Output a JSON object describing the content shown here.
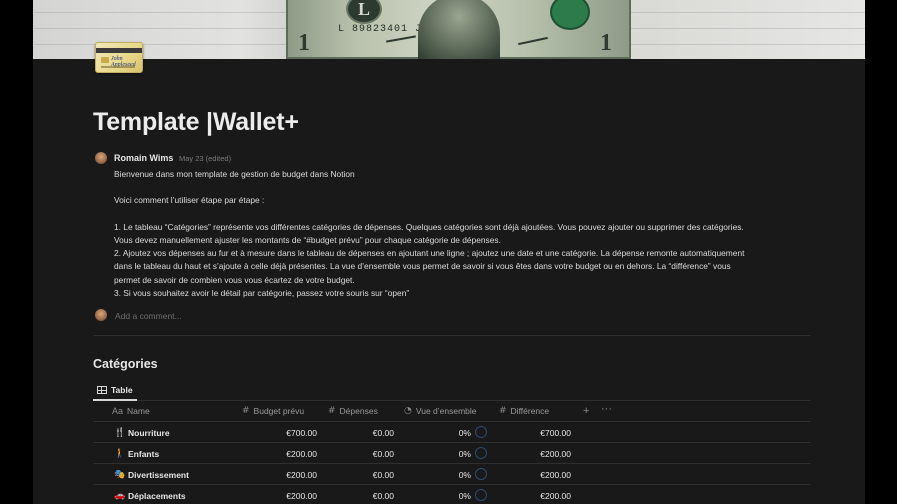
{
  "page": {
    "title": "Template |Wallet+",
    "icon": "credit-card-icon",
    "cover": "dollar-bill-cover-image",
    "cover_text": {
      "serial": "L 89823401 J",
      "seal_letter": "L",
      "denomination": "1"
    },
    "card_icon_signature": "John Appleseed"
  },
  "comment": {
    "author": "Romain Wims",
    "meta": "May 23 (edited)",
    "lines": [
      "Bienvenue dans mon template de gestion de budget dans Notion",
      "",
      "Voici comment l’utiliser étape par étape :",
      "",
      "1. Le tableau “Catégories” représente vos différentes catégories de dépenses. Quelques catégories sont déjà ajoutées. Vous pouvez ajouter ou supprimer des catégories.",
      "Vous devez manuellement ajuster les montants de “#budget prévu” pour chaque catégorie de dépenses.",
      "2. Ajoutez vos dépenses au fur et à mesure dans le tableau de dépenses en ajoutant une ligne ; ajoutez une date et une catégorie. La dépense remonte automatiquement",
      "dans le tableau du haut et s’ajoute à celle déjà présentes. La vue d’ensemble vous permet de savoir si vous êtes dans votre budget ou en dehors. La “différence” vous",
      "permet de savoir de combien vous vous écartez de votre budget.",
      "3. Si vous souhaitez avoir le détail par catégorie, passez votre souris sur “open”"
    ]
  },
  "add_comment": {
    "placeholder": "Add a comment..."
  },
  "section": {
    "title": "Catégories",
    "view_tab": "Table"
  },
  "table": {
    "columns": [
      {
        "label": "Name",
        "icon": "Aa"
      },
      {
        "label": "Budget prévu",
        "icon": "#"
      },
      {
        "label": "Dépenses",
        "icon": "#"
      },
      {
        "label": "Vue d’ensemble",
        "icon": "progress-icon"
      },
      {
        "label": "Différence",
        "icon": "#"
      }
    ],
    "add_column": "+",
    "more": "···",
    "rows": [
      {
        "icon": "fork-knife-icon",
        "glyph": "🍴",
        "name": "Nourriture",
        "budget": "€700.00",
        "depenses": "€0.00",
        "progress": "0%",
        "difference": "€700.00"
      },
      {
        "icon": "child-icon",
        "glyph": "🚶",
        "name": "Enfants",
        "budget": "€200.00",
        "depenses": "€0.00",
        "progress": "0%",
        "difference": "€200.00"
      },
      {
        "icon": "theater-masks-icon",
        "glyph": "🎭",
        "name": "Divertissement",
        "budget": "€200.00",
        "depenses": "€0.00",
        "progress": "0%",
        "difference": "€200.00"
      },
      {
        "icon": "car-icon",
        "glyph": "🚗",
        "name": "Déplacements",
        "budget": "€200.00",
        "depenses": "€0.00",
        "progress": "0%",
        "difference": "€200.00"
      }
    ]
  },
  "colors": {
    "background": "#191919",
    "text": "#e6e6e6",
    "muted": "#9b9b9b",
    "divider": "#2f2f2f",
    "progress_ring": "#2f4a6b"
  }
}
